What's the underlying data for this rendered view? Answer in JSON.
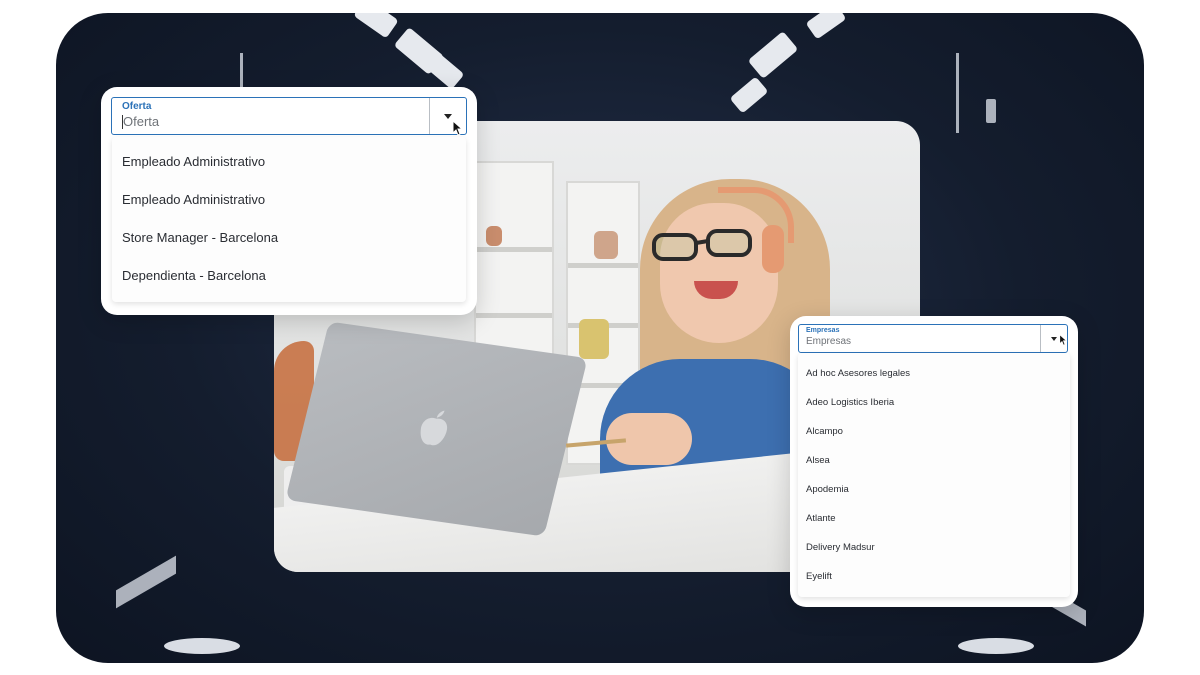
{
  "colors": {
    "accent": "#2b72b8",
    "frame_bg": "#141d2e",
    "sweater": "#3d6fb0"
  },
  "oferta_dropdown": {
    "label": "Oferta",
    "placeholder": "Oferta",
    "toggle_icon": "caret-down-icon",
    "options": [
      "Empleado Administrativo",
      "Empleado Administrativo",
      "Store Manager - Barcelona",
      "Dependienta - Barcelona"
    ]
  },
  "empresas_dropdown": {
    "label": "Empresas",
    "placeholder": "Empresas",
    "toggle_icon": "caret-down-icon",
    "options": [
      "Ad hoc Asesores legales",
      "Adeo Logistics Iberia",
      "Alcampo",
      "Alsea",
      "Apodemia",
      "Atlante",
      "Delivery Madsur",
      "Eyelift"
    ]
  }
}
